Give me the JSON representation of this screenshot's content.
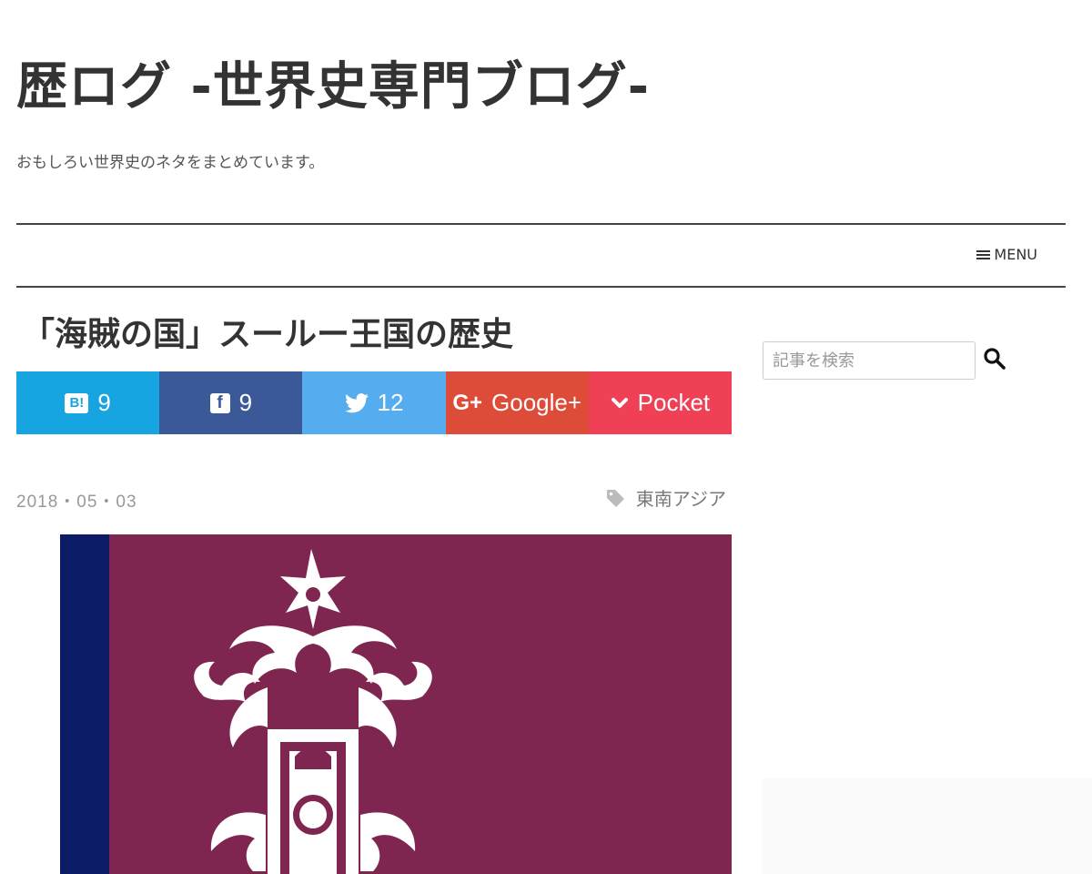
{
  "site": {
    "title": "歴ログ -世界史専門ブログ-",
    "description": "おもしろい世界史のネタをまとめています。"
  },
  "nav": {
    "menu_label": "MENU"
  },
  "post": {
    "title": "「海賊の国」スールー王国の歴史",
    "date": "2018・05・03",
    "tag": "東南アジア"
  },
  "share": {
    "hatena": {
      "icon": "B!",
      "count": "9",
      "color": "#16a5e1"
    },
    "facebook": {
      "icon": "f",
      "count": "9",
      "color": "#3b5998"
    },
    "twitter": {
      "count": "12",
      "color": "#55acee"
    },
    "google": {
      "icon": "G+",
      "label": "Google+",
      "color": "#dd4b39"
    },
    "pocket": {
      "label": "Pocket",
      "color": "#ef4056"
    }
  },
  "sidebar": {
    "search_placeholder": "記事を検索"
  },
  "colors": {
    "flag_maroon": "#7f2650",
    "flag_navy": "#0c1b66"
  }
}
